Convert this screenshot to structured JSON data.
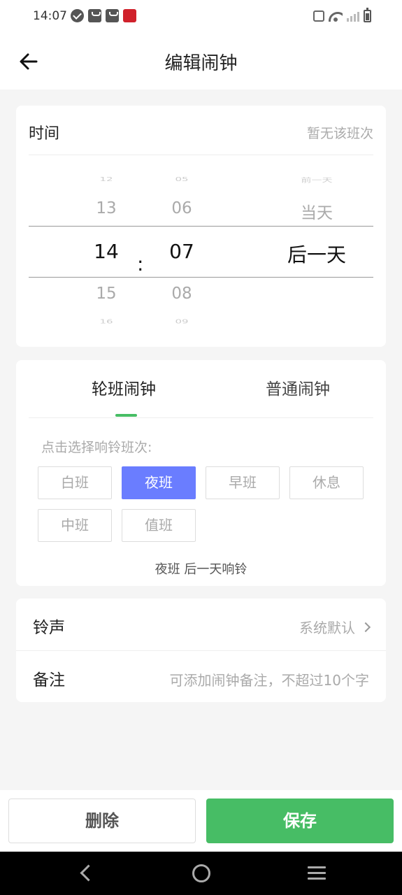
{
  "status_bar": {
    "time": "14:07"
  },
  "header": {
    "title": "编辑闹钟"
  },
  "time_card": {
    "label": "时间",
    "hint": "暂无该班次",
    "hours": [
      "12",
      "13",
      "14",
      "15",
      "16"
    ],
    "minutes": [
      "05",
      "06",
      "07",
      "08",
      "09"
    ],
    "days": [
      "前一天",
      "当天",
      "后一天"
    ],
    "separator": ":",
    "selected": {
      "hour": "14",
      "minute": "07",
      "day": "后一天"
    }
  },
  "shift_card": {
    "tabs": [
      {
        "label": "轮班闹钟",
        "active": true
      },
      {
        "label": "普通闹钟",
        "active": false
      }
    ],
    "prompt": "点击选择响铃班次:",
    "shifts": [
      {
        "label": "白班",
        "selected": false
      },
      {
        "label": "夜班",
        "selected": true
      },
      {
        "label": "早班",
        "selected": false
      },
      {
        "label": "休息",
        "selected": false
      },
      {
        "label": "中班",
        "selected": false
      },
      {
        "label": "值班",
        "selected": false
      }
    ],
    "result": "夜班 后一天响铃"
  },
  "settings": {
    "ringtone_label": "铃声",
    "ringtone_value": "系统默认",
    "note_label": "备注",
    "note_placeholder": "可添加闹钟备注，不超过10个字"
  },
  "buttons": {
    "delete": "删除",
    "save": "保存"
  },
  "colors": {
    "accent": "#47bd65",
    "selected_chip": "#6a7dff"
  }
}
